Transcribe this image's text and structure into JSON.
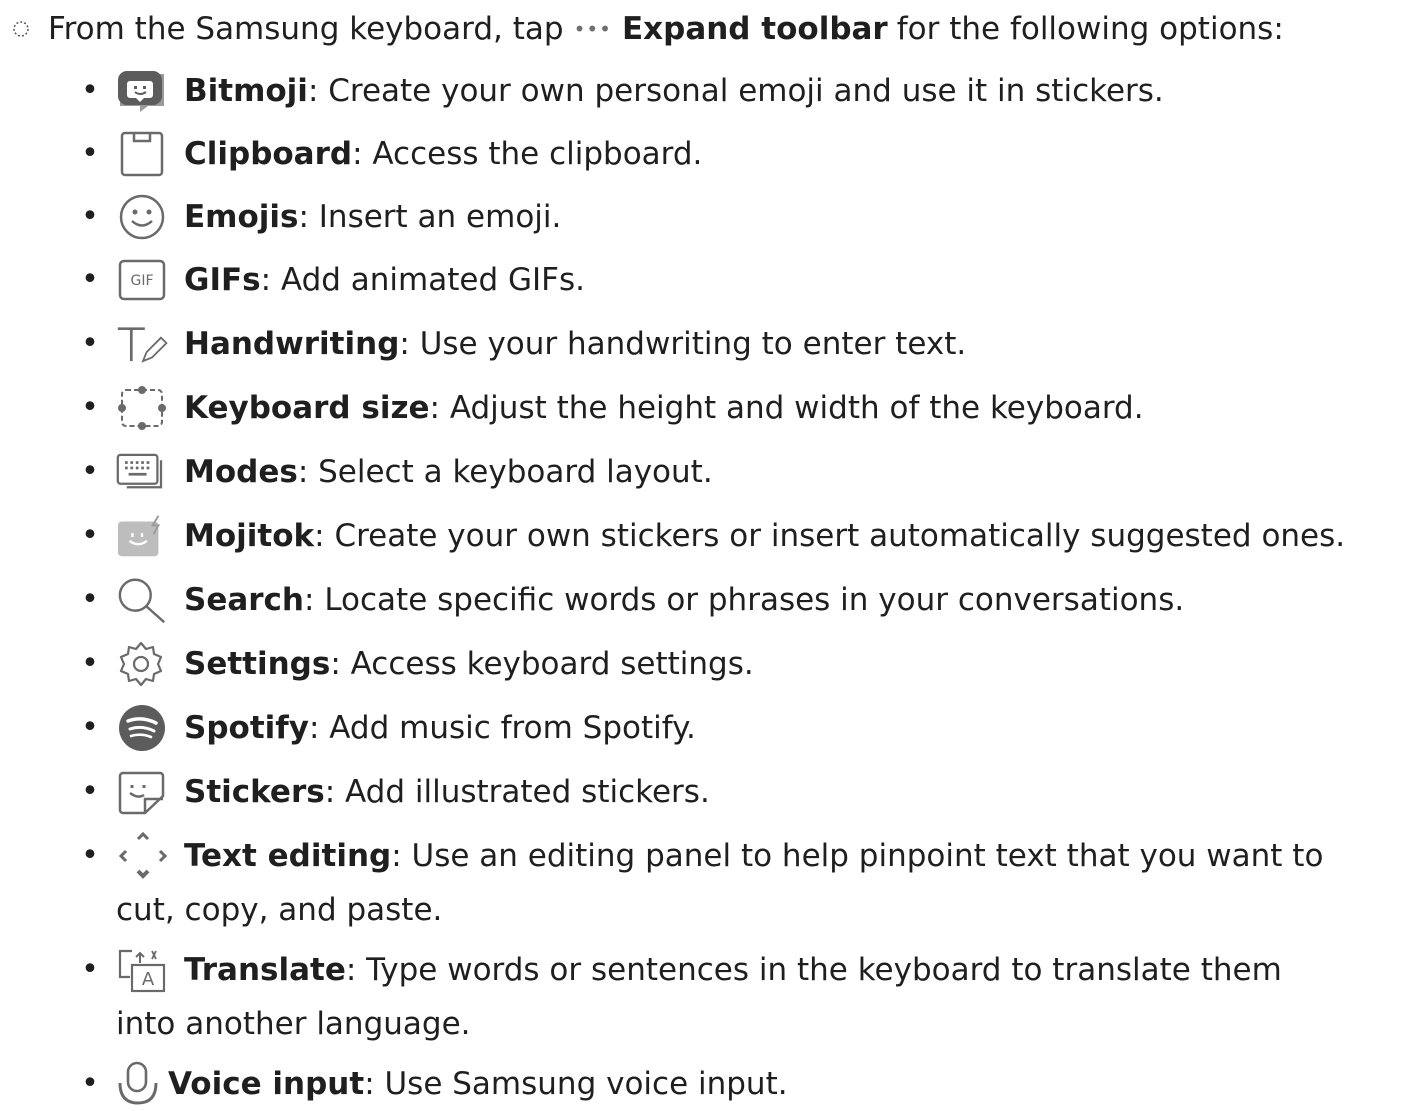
{
  "intro": {
    "prefix": "From the Samsung keyboard, tap",
    "dots": "•••",
    "bold": "Expand toolbar",
    "suffix": "for the following options:"
  },
  "items": [
    {
      "icon": "bitmoji-icon",
      "title": "Bitmoji",
      "desc": ": Create your own personal emoji and use it in stickers."
    },
    {
      "icon": "clipboard-icon",
      "title": "Clipboard",
      "desc": ": Access the clipboard."
    },
    {
      "icon": "emoji-icon",
      "title": "Emojis",
      "desc": ": Insert an emoji."
    },
    {
      "icon": "gif-icon",
      "title": "GIFs",
      "desc": ": Add animated GIFs."
    },
    {
      "icon": "handwriting-icon",
      "title": "Handwriting",
      "desc": ": Use your handwriting to enter text."
    },
    {
      "icon": "keyboard-size-icon",
      "title": "Keyboard size",
      "desc": ": Adjust the height and width of the keyboard."
    },
    {
      "icon": "modes-icon",
      "title": "Modes",
      "desc": ": Select a keyboard layout."
    },
    {
      "icon": "mojitok-icon",
      "title": "Mojitok",
      "desc": ": Create your own stickers or insert automatically suggested ones."
    },
    {
      "icon": "search-icon",
      "title": "Search",
      "desc": ": Locate specific words or phrases in your conversations."
    },
    {
      "icon": "settings-icon",
      "title": "Settings",
      "desc": ": Access keyboard settings."
    },
    {
      "icon": "spotify-icon",
      "title": "Spotify",
      "desc": ": Add music from Spotify."
    },
    {
      "icon": "stickers-icon",
      "title": "Stickers",
      "desc": ": Add illustrated stickers."
    },
    {
      "icon": "text-editing-icon",
      "title": "Text editing",
      "desc": ": Use an editing panel to help pinpoint text that you want to",
      "cont": "cut, copy, and paste."
    },
    {
      "icon": "translate-icon",
      "title": "Translate",
      "desc": ": Type words or sentences in the keyboard to translate them",
      "cont": "into another language."
    },
    {
      "icon": "voice-input-icon",
      "title": "Voice input",
      "desc": ": Use Samsung voice input."
    }
  ],
  "gif_label": "GIF",
  "translate_label": "A",
  "colors": {
    "text": "#1f1f1f",
    "icon": "#7a7a7a",
    "icon_dark": "#5e5e5e"
  }
}
